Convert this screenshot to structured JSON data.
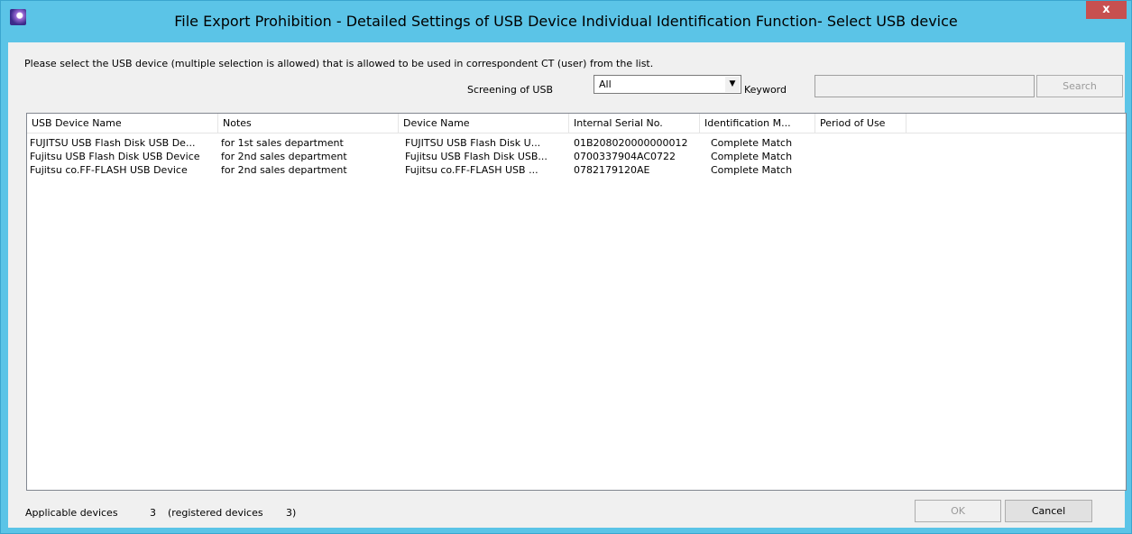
{
  "window": {
    "title": "File Export Prohibition - Detailed Settings of USB Device Individual Identification Function- Select USB device",
    "close_glyph": "x"
  },
  "instruction": "Please select the USB device (multiple selection is allowed) that is allowed to be used in correspondent CT (user) from the list.",
  "filters": {
    "screening_label": "Screening of USB",
    "screening_value": "All",
    "keyword_label": "Keyword",
    "keyword_value": "",
    "search_label": "Search"
  },
  "table": {
    "columns": [
      "USB Device Name",
      "Notes",
      "Device Name",
      "Internal Serial No.",
      "Identification M...",
      "Period of Use"
    ],
    "rows": [
      [
        "FUJITSU USB Flash Disk USB De...",
        "for 1st sales department",
        "FUJITSU USB Flash Disk U...",
        "01B208020000000012",
        "Complete Match",
        ""
      ],
      [
        "Fujitsu USB Flash Disk USB Device",
        "for 2nd sales department",
        "Fujitsu USB Flash Disk USB...",
        "0700337904AC0722",
        "Complete Match",
        ""
      ],
      [
        "Fujitsu co.FF-FLASH USB Device",
        "for 2nd sales department",
        "Fujitsu co.FF-FLASH USB ...",
        "0782179120AE",
        "Complete Match",
        ""
      ]
    ]
  },
  "footer": {
    "applicable_label": "Applicable devices",
    "applicable_count": "3",
    "registered_label": "(registered devices",
    "registered_count": "3)",
    "ok_label": "OK",
    "cancel_label": "Cancel"
  },
  "colors": {
    "titlebar": "#5bc4e7",
    "close_button": "#c75050",
    "dialog_background": "#f0f0f0",
    "disabled_text": "#9a9a9a"
  }
}
